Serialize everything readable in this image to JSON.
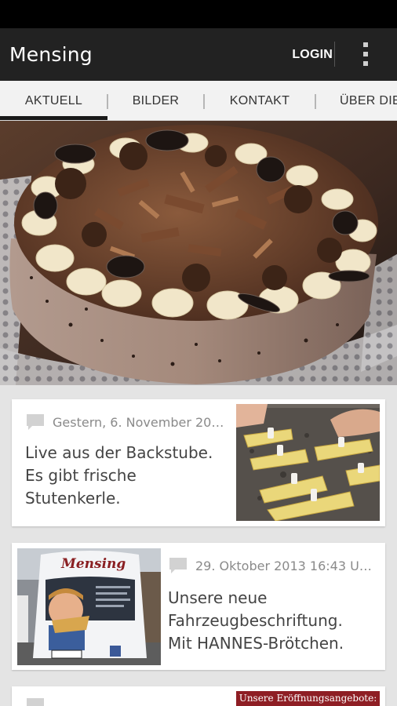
{
  "app": {
    "title": "Mensing"
  },
  "actionbar": {
    "login_label": "LOGIN",
    "overflow_icon": "overflow-menu-icon"
  },
  "tabs": [
    {
      "label": "AKTUELL",
      "active": true
    },
    {
      "label": "BILDER",
      "active": false
    },
    {
      "label": "KONTAKT",
      "active": false
    },
    {
      "label": "ÜBER DIE",
      "active": false
    }
  ],
  "hero": {
    "image": "chocolate-cream-cake-photo"
  },
  "feed": [
    {
      "meta": "Gestern, 6. November 20…",
      "text_lines": [
        "Live aus der Backstube.",
        "Es gibt frische",
        "Stutenkerle."
      ],
      "image": "stutenkerle-baking-tray-photo"
    },
    {
      "meta": "29. Oktober 2013 16:43 U…",
      "text_lines": [
        "Unsere neue",
        "Fahrzeugbeschriftung.",
        "Mit HANNES-Brötchen."
      ],
      "image": "mensing-van-photo",
      "van_brand": "Mensing"
    },
    {
      "image_caption": "Unsere Eröffnungsangebote:"
    }
  ],
  "colors": {
    "actionbar": "#222222",
    "tabbar": "#f2f2f2",
    "background": "#e4e4e4",
    "card": "#ffffff",
    "meta": "#8a8a8a",
    "text": "#444444"
  }
}
